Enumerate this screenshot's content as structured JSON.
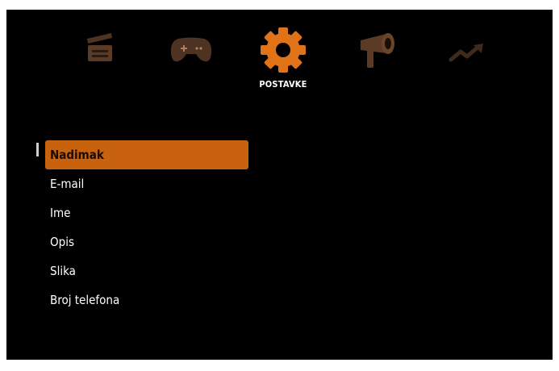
{
  "nav": {
    "items": [
      {
        "icon": "clapperboard-icon",
        "label": ""
      },
      {
        "icon": "gamepad-icon",
        "label": ""
      },
      {
        "icon": "gear-icon",
        "label": "POSTAVKE"
      },
      {
        "icon": "megaphone-icon",
        "label": ""
      },
      {
        "icon": "trending-up-icon",
        "label": ""
      }
    ],
    "active_index": 2
  },
  "menu": {
    "items": [
      {
        "label": "Nadimak"
      },
      {
        "label": "E-mail"
      },
      {
        "label": "Ime"
      },
      {
        "label": "Opis"
      },
      {
        "label": "Slika"
      },
      {
        "label": "Broj telefona"
      }
    ],
    "selected_index": 0
  },
  "colors": {
    "background": "#000000",
    "accent": "#c8620f",
    "active_icon": "#e07318",
    "inactive_icon": "#5a3a24",
    "text": "#ffffff"
  }
}
